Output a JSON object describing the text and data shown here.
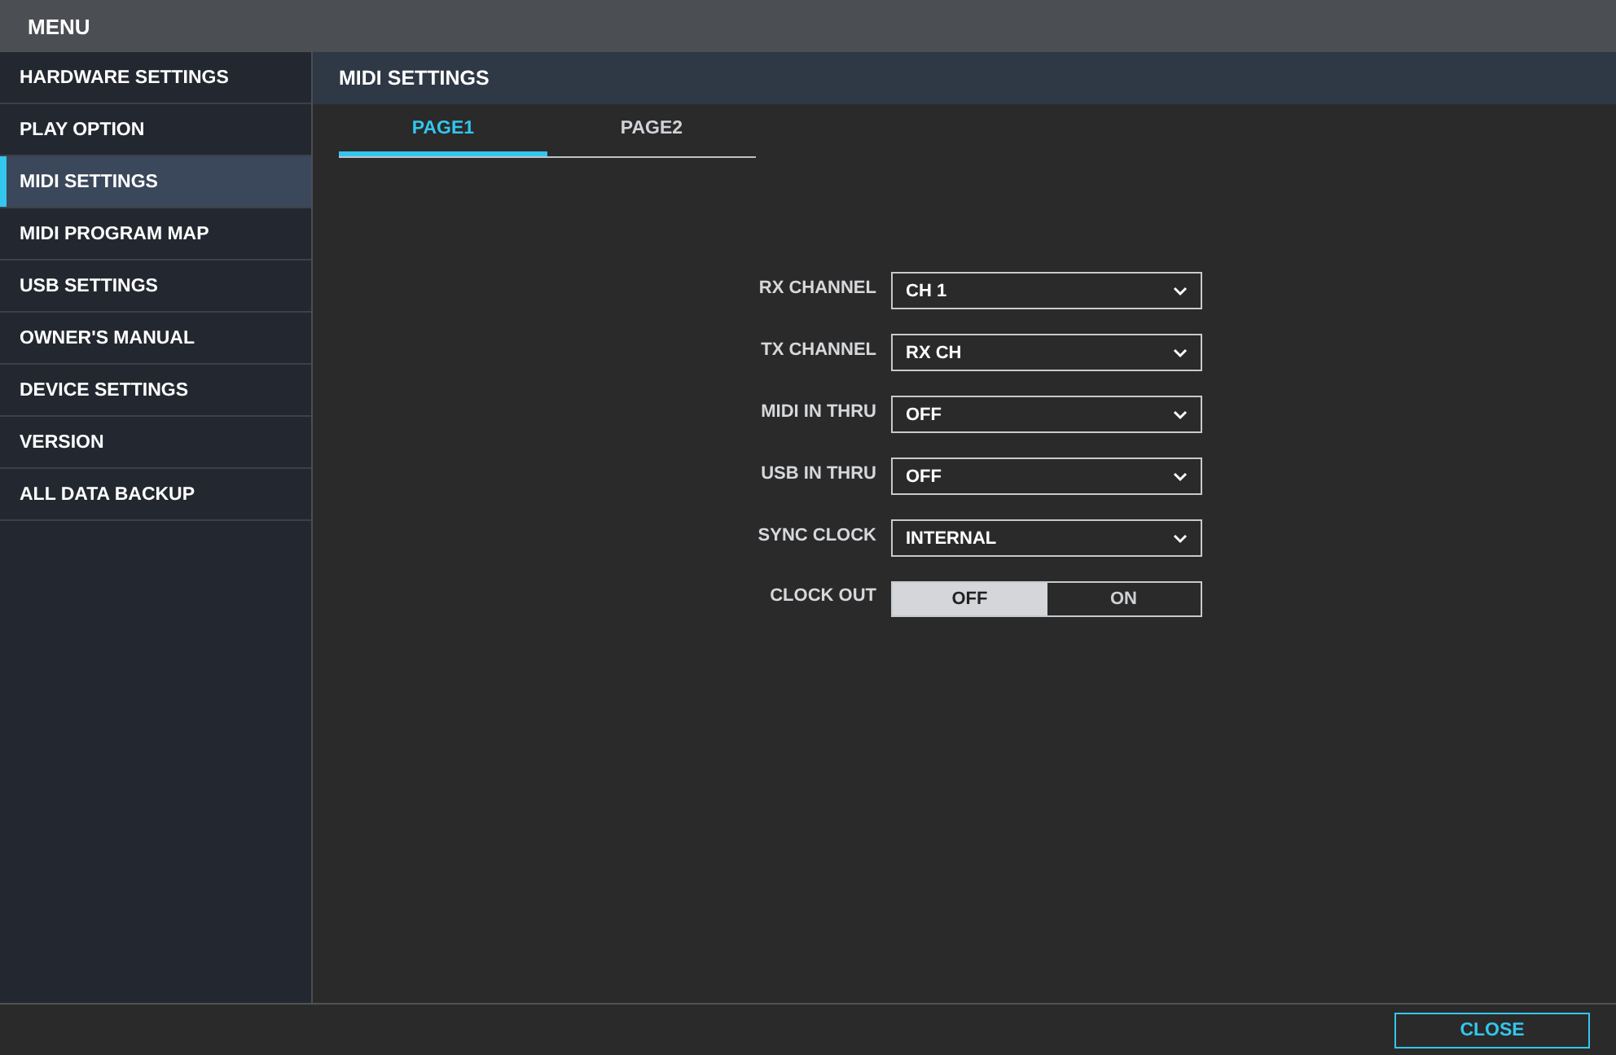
{
  "window": {
    "title": "MENU"
  },
  "sidebar": {
    "items": [
      {
        "label": "HARDWARE SETTINGS",
        "selected": false
      },
      {
        "label": "PLAY OPTION",
        "selected": false
      },
      {
        "label": "MIDI SETTINGS",
        "selected": true
      },
      {
        "label": "MIDI PROGRAM MAP",
        "selected": false
      },
      {
        "label": "USB SETTINGS",
        "selected": false
      },
      {
        "label": "OWNER'S MANUAL",
        "selected": false
      },
      {
        "label": "DEVICE SETTINGS",
        "selected": false
      },
      {
        "label": "VERSION",
        "selected": false
      },
      {
        "label": "ALL DATA BACKUP",
        "selected": false
      }
    ]
  },
  "panel": {
    "title": "MIDI SETTINGS",
    "tabs": [
      {
        "label": "PAGE1",
        "selected": true
      },
      {
        "label": "PAGE2",
        "selected": false
      }
    ],
    "settings": [
      {
        "kind": "select",
        "label": "RX CHANNEL",
        "value": "CH 1"
      },
      {
        "kind": "select",
        "label": "TX CHANNEL",
        "value": "RX CH"
      },
      {
        "kind": "select",
        "label": "MIDI IN THRU",
        "value": "OFF"
      },
      {
        "kind": "select",
        "label": "USB IN THRU",
        "value": "OFF"
      },
      {
        "kind": "select",
        "label": "SYNC CLOCK",
        "value": "INTERNAL"
      },
      {
        "kind": "toggle",
        "label": "CLOCK OUT",
        "options": [
          {
            "label": "OFF",
            "selected": true
          },
          {
            "label": "ON",
            "selected": false
          }
        ]
      }
    ]
  },
  "footer": {
    "close_button": "CLOSE"
  }
}
